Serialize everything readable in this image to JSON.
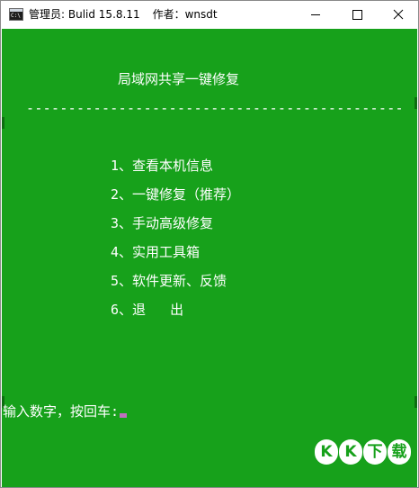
{
  "window": {
    "title_left": "管理员:  Bulid 15.8.11",
    "title_right": "作者：wnsdt",
    "icon_text": "C:\\"
  },
  "console": {
    "heading": "局域网共享一键修复",
    "divider": "---------------------------------------------",
    "menu": [
      "1、查看本机信息",
      "2、一键修复（推荐）",
      "3、手动高级修复",
      "4、实用工具箱",
      "5、软件更新、反馈",
      "6、退   出"
    ],
    "prompt": "输入数字，按回车:"
  },
  "watermark": {
    "chars": [
      "K",
      "K",
      "下",
      "载"
    ]
  },
  "colors": {
    "console_bg": "#17a11b",
    "console_fg": "#ffffff",
    "cursor": "#c070c0"
  }
}
